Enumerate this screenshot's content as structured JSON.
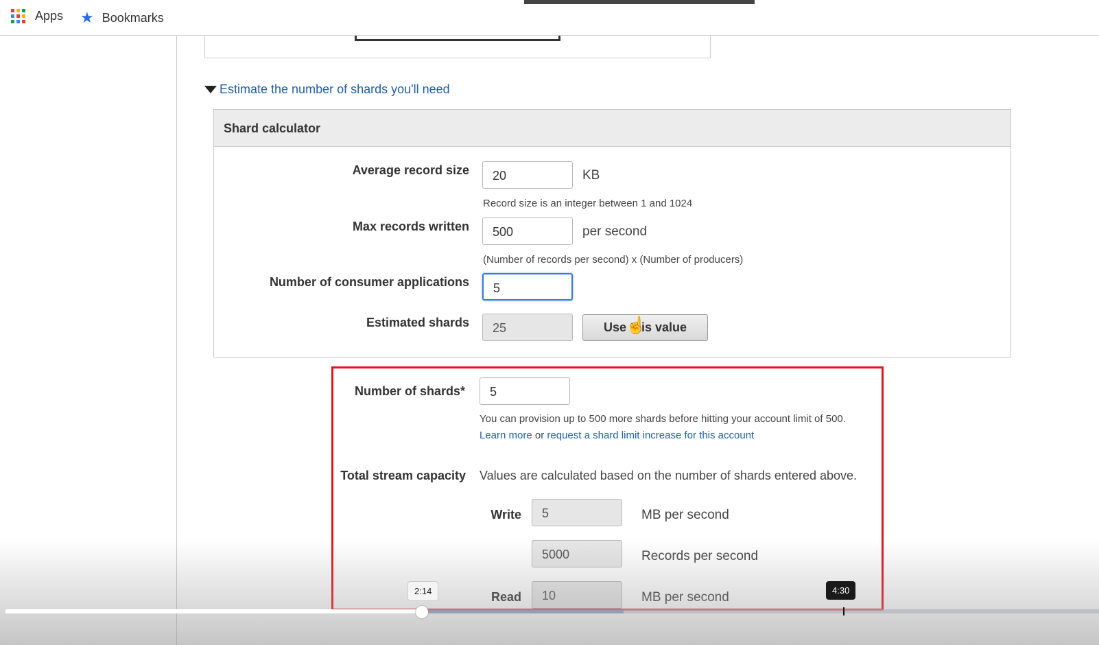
{
  "bookmarks_bar": {
    "apps_label": "Apps",
    "bookmarks_label": "Bookmarks"
  },
  "estimate": {
    "link_text": "Estimate the number of shards you'll need"
  },
  "calculator": {
    "title": "Shard calculator",
    "avg_record_size": {
      "label": "Average record size",
      "value": "20",
      "unit": "KB",
      "hint": "Record size is an integer between 1 and 1024"
    },
    "max_records": {
      "label": "Max records written",
      "value": "500",
      "unit": "per second",
      "hint": "(Number of records per second) x (Number of producers)"
    },
    "consumers": {
      "label": "Number of consumer applications",
      "value": "5"
    },
    "estimated": {
      "label": "Estimated shards",
      "value": "25",
      "button": "Use this value"
    }
  },
  "shards": {
    "label": "Number of shards*",
    "value": "5",
    "hint": "You can provision up to 500 more shards before hitting your account limit of 500.",
    "learn_more": "Learn more",
    "or": "or",
    "request_link": "request a shard limit increase for this account"
  },
  "capacity": {
    "label": "Total stream capacity",
    "description": "Values are calculated based on the number of shards entered above.",
    "write_label": "Write",
    "write_mb": "5",
    "write_mb_unit": "MB per second",
    "write_records": "5000",
    "write_records_unit": "Records per second",
    "read_label": "Read",
    "read_mb": "10",
    "read_mb_unit": "MB per second"
  },
  "video": {
    "hover_time": "2:14",
    "chapter_time": "4:30",
    "played_fraction": 0.385,
    "buffered_start": 0.385,
    "buffered_end": 0.565
  },
  "colors": {
    "link": "#1f5fa8",
    "highlight_box": "#e0151b",
    "focus_border": "#3a7ad9"
  }
}
